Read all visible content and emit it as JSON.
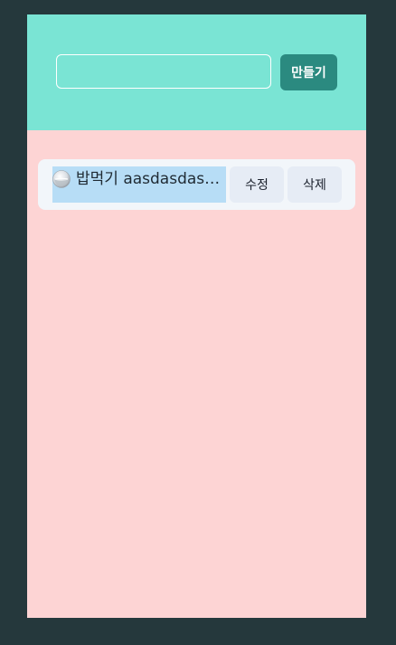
{
  "header": {
    "input_value": "",
    "input_placeholder": "",
    "create_label": "만들기"
  },
  "todos": [
    {
      "icon": "rice-bowl-icon",
      "text": "밥먹기 aasdasdasdasd",
      "edit_label": "수정",
      "delete_label": "삭제"
    }
  ],
  "colors": {
    "outer_background": "#25383c",
    "header_background": "#7ae4d4",
    "list_background": "#fdd4d4",
    "create_button": "#2b8a80",
    "item_background": "#f2f6fa",
    "selected_text": "#b7ddf6",
    "action_button": "#e6ecf5"
  }
}
